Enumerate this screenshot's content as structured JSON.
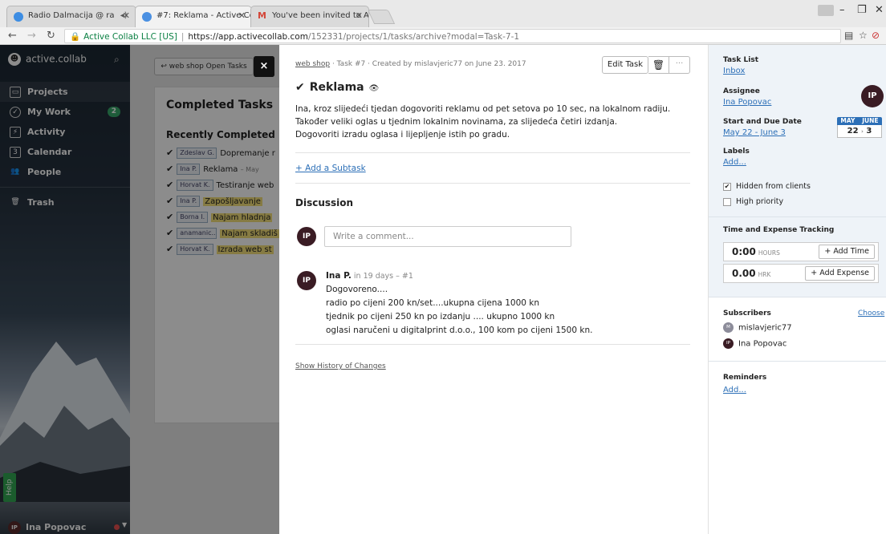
{
  "browser": {
    "tabs": [
      {
        "title": "Radio Dalmacija @ ra",
        "favicon_color": "#3d8de3"
      },
      {
        "title": "#7: Reklama - Active Coll",
        "favicon_color": "#4a90e2"
      },
      {
        "title": "You've been invited to A",
        "favicon_color": "#d44638"
      }
    ],
    "secure_label": "Active Collab LLC [US]",
    "url_host": "https://app.activecollab.com",
    "url_path": "/152331/projects/1/tasks/archive?modal=Task-7-1"
  },
  "sidebar": {
    "brand": "active.collab",
    "items": [
      {
        "label": "Projects",
        "icon": "folder-icon"
      },
      {
        "label": "My Work",
        "icon": "check-circle-icon",
        "badge": "2"
      },
      {
        "label": "Activity",
        "icon": "activity-icon"
      },
      {
        "label": "Calendar",
        "icon": "calendar-icon"
      },
      {
        "label": "People",
        "icon": "people-icon"
      },
      {
        "label": "Trash",
        "icon": "trash-icon"
      }
    ],
    "help": "Help",
    "user_initials": "IP",
    "user_name": "Ina Popovac"
  },
  "background": {
    "open_tasks_button": "↩ web shop Open Tasks",
    "close": "×",
    "completed_title": "Completed Tasks",
    "recently_completed": "Recently Completed",
    "rows": [
      {
        "who": "Zdeslav G.",
        "text": "Dopremanje r",
        "highlight": false,
        "date": ""
      },
      {
        "who": "Ina P.",
        "text": "Reklama",
        "highlight": false,
        "date": "– May"
      },
      {
        "who": "Horvat K.",
        "text": "Testiranje web",
        "highlight": false,
        "date": ""
      },
      {
        "who": "Ina P.",
        "text": "Zapošljavanje",
        "highlight": true,
        "date": ""
      },
      {
        "who": "Borna I.",
        "text": "Najam hladnja",
        "highlight": true,
        "date": ""
      },
      {
        "who": "anamanic...",
        "text": "Najam skladiš",
        "highlight": true,
        "date": ""
      },
      {
        "who": "Horvat K.",
        "text": "Izrada web st",
        "highlight": true,
        "date": ""
      }
    ]
  },
  "task": {
    "breadcrumb_project": "web shop",
    "breadcrumb_rest": " · Task #7 · Created by mislavjeric77 on June 23. 2017",
    "edit_button": "Edit Task",
    "title": "Reklama",
    "description": [
      "Ina, kroz slijedeći tjedan dogovoriti reklamu od pet setova po 10 sec, na lokalnom radiju.",
      "Također veliki oglas u tjednim lokalnim novinama, za slijedeća četiri izdanja.",
      "Dogovoriti izradu oglasa i lijepljenje istih po gradu."
    ],
    "add_subtask": "+ Add a Subtask",
    "discussion_title": "Discussion",
    "comment_placeholder": "Write a comment...",
    "comment": {
      "author": "Ina P.",
      "meta": " in 19 days – #1",
      "lines": [
        "Dogovoreno....",
        "radio po cijeni 200 kn/set....ukupna cijena 1000 kn",
        "tjednik po cijeni 250 kn po izdanju .... ukupno 1000 kn",
        "oglasi naručeni u digitalprint d.o.o., 100 kom po cijeni 1500 kn."
      ]
    },
    "show_history": "Show History of Changes"
  },
  "details": {
    "task_list_label": "Task List",
    "task_list_value": "Inbox",
    "assignee_label": "Assignee",
    "assignee_value": "Ina Popovac",
    "dates_label": "Start and Due Date",
    "dates_value": "May 22 - June 3",
    "date_badge": {
      "start_month": "MAY",
      "end_month": "JUNE",
      "start_day": "22",
      "end_day": "3"
    },
    "labels_label": "Labels",
    "labels_add": "Add...",
    "hidden_from_clients": "Hidden from clients",
    "hidden_checked": true,
    "high_priority": "High priority",
    "high_priority_checked": false,
    "tracking_title": "Time and Expense Tracking",
    "hours_value": "0:00",
    "hours_unit": "HOURS",
    "add_time": "+ Add Time",
    "expense_value": "0.00",
    "expense_unit": "HRK",
    "add_expense": "+ Add Expense",
    "subscribers_label": "Subscribers",
    "choose": "Choose",
    "subscribers": [
      {
        "initials": "M",
        "name": "mislavjeric77",
        "color": "#8c8c9a"
      },
      {
        "initials": "IP",
        "name": "Ina Popovac",
        "color": "#3a1c24"
      }
    ],
    "reminders_label": "Reminders",
    "reminders_add": "Add..."
  }
}
